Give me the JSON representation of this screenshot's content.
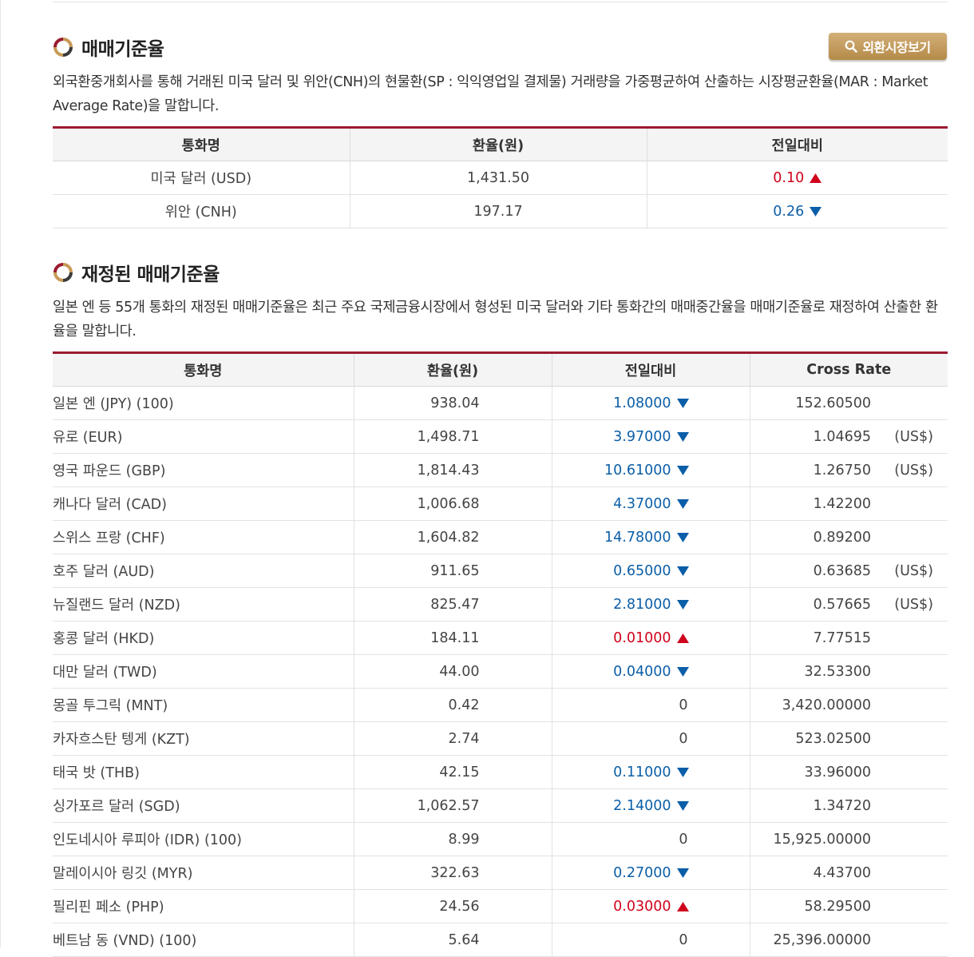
{
  "section1": {
    "title": "매매기준율",
    "button_label": "외환시장보기",
    "description": "외국환중개회사를 통해 거래된 미국 달러 및 위안(CNH)의 현물환(SP : 익익영업일 결제물) 거래량을 가중평균하여 산출하는 시장평균환율(MAR : Market Average Rate)을 말합니다.",
    "headers": [
      "통화명",
      "환율(원)",
      "전일대비"
    ],
    "rows": [
      {
        "name": "미국 달러 (USD)",
        "rate": "1,431.50",
        "change": "0.10",
        "dir": "up"
      },
      {
        "name": "위안 (CNH)",
        "rate": "197.17",
        "change": "0.26",
        "dir": "down"
      }
    ]
  },
  "section2": {
    "title": "재정된 매매기준율",
    "description": "일본 엔 등 55개 통화의 재정된 매매기준율은 최근 주요 국제금융시장에서 형성된 미국 달러와 기타 통화간의 매매중간율을 매매기준율로 재정하여 산출한 환율을 말합니다.",
    "headers": [
      "통화명",
      "환율(원)",
      "전일대비",
      "Cross Rate"
    ],
    "rows": [
      {
        "name": "일본 엔 (JPY) (100)",
        "rate": "938.04",
        "change": "1.08000",
        "dir": "down",
        "cross": "152.60500",
        "unit": ""
      },
      {
        "name": "유로 (EUR)",
        "rate": "1,498.71",
        "change": "3.97000",
        "dir": "down",
        "cross": "1.04695",
        "unit": "(US$)"
      },
      {
        "name": "영국 파운드 (GBP)",
        "rate": "1,814.43",
        "change": "10.61000",
        "dir": "down",
        "cross": "1.26750",
        "unit": "(US$)"
      },
      {
        "name": "캐나다 달러 (CAD)",
        "rate": "1,006.68",
        "change": "4.37000",
        "dir": "down",
        "cross": "1.42200",
        "unit": ""
      },
      {
        "name": "스위스 프랑 (CHF)",
        "rate": "1,604.82",
        "change": "14.78000",
        "dir": "down",
        "cross": "0.89200",
        "unit": ""
      },
      {
        "name": "호주 달러 (AUD)",
        "rate": "911.65",
        "change": "0.65000",
        "dir": "down",
        "cross": "0.63685",
        "unit": "(US$)"
      },
      {
        "name": "뉴질랜드 달러 (NZD)",
        "rate": "825.47",
        "change": "2.81000",
        "dir": "down",
        "cross": "0.57665",
        "unit": "(US$)"
      },
      {
        "name": "홍콩 달러 (HKD)",
        "rate": "184.11",
        "change": "0.01000",
        "dir": "up",
        "cross": "7.77515",
        "unit": ""
      },
      {
        "name": "대만 달러 (TWD)",
        "rate": "44.00",
        "change": "0.04000",
        "dir": "down",
        "cross": "32.53300",
        "unit": ""
      },
      {
        "name": "몽골 투그릭 (MNT)",
        "rate": "0.42",
        "change": "0",
        "dir": "none",
        "cross": "3,420.00000",
        "unit": ""
      },
      {
        "name": "카자흐스탄 텡게 (KZT)",
        "rate": "2.74",
        "change": "0",
        "dir": "none",
        "cross": "523.02500",
        "unit": ""
      },
      {
        "name": "태국 밧 (THB)",
        "rate": "42.15",
        "change": "0.11000",
        "dir": "down",
        "cross": "33.96000",
        "unit": ""
      },
      {
        "name": "싱가포르 달러 (SGD)",
        "rate": "1,062.57",
        "change": "2.14000",
        "dir": "down",
        "cross": "1.34720",
        "unit": ""
      },
      {
        "name": "인도네시아 루피아 (IDR) (100)",
        "rate": "8.99",
        "change": "0",
        "dir": "none",
        "cross": "15,925.00000",
        "unit": ""
      },
      {
        "name": "말레이시아 링깃 (MYR)",
        "rate": "322.63",
        "change": "0.27000",
        "dir": "down",
        "cross": "4.43700",
        "unit": ""
      },
      {
        "name": "필리핀 페소 (PHP)",
        "rate": "24.56",
        "change": "0.03000",
        "dir": "up",
        "cross": "58.29500",
        "unit": ""
      },
      {
        "name": "베트남 동 (VND) (100)",
        "rate": "5.64",
        "change": "0",
        "dir": "none",
        "cross": "25,396.00000",
        "unit": ""
      }
    ]
  },
  "colors": {
    "accent": "#9b1b30",
    "up": "#d0021b",
    "down": "#0b5ea8",
    "button": "#c09a5b"
  },
  "icons": {
    "title": "bullet-ring-icon",
    "button": "search-icon",
    "up": "triangle-up-icon",
    "down": "triangle-down-icon"
  }
}
